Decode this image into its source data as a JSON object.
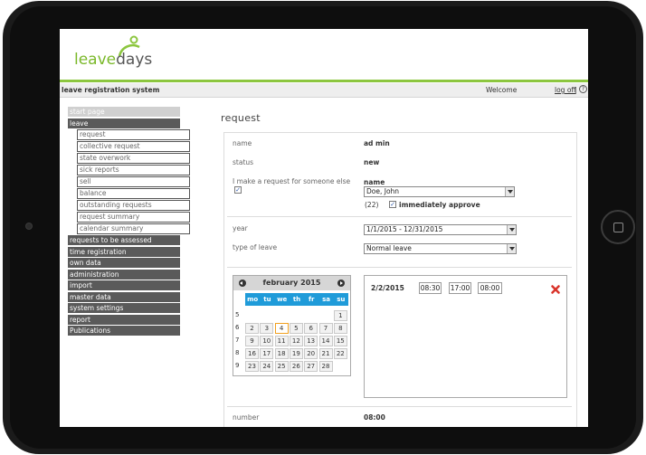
{
  "app": {
    "logo_part1": "leave",
    "logo_part2": "days",
    "system_name": "leave registration system",
    "welcome": "Welcome",
    "logoff": "log off",
    "separator": "|",
    "help_icon": "?"
  },
  "colors": {
    "brand_green": "#8cc63f",
    "calendar_blue": "#1f9bd9",
    "menu_dark": "#5a5a5a"
  },
  "menu": {
    "start_page": "start page",
    "leave": "leave",
    "sub": [
      "request",
      "collective request",
      "state overwork",
      "sick reports",
      "sell",
      "balance",
      "outstanding requests",
      "request summary",
      "calendar summary"
    ],
    "sections": [
      "requests to be assessed",
      "time registration",
      "own data",
      "administration",
      "import",
      "master data",
      "system settings",
      "report",
      "Publications"
    ]
  },
  "form": {
    "title": "request",
    "name_label": "name",
    "name_value": "ad min",
    "status_label": "status",
    "status_value": "new",
    "someone_else_label": "I make a request for someone else",
    "someone_else_checked": "✓",
    "person_label": "name",
    "person_value": "Doe, John",
    "count": "(22)",
    "approve_checked": "✓",
    "approve_label": "immediately approve",
    "year_label": "year",
    "year_value": "1/1/2015 - 12/31/2015",
    "type_label": "type of leave",
    "type_value": "Normal leave",
    "number_label": "number",
    "number_value": "08:00"
  },
  "calendar": {
    "month": "february 2015",
    "weekdays": [
      "mo",
      "tu",
      "we",
      "th",
      "fr",
      "sa",
      "su"
    ],
    "weeks": [
      {
        "wk": "5",
        "days": [
          "",
          "",
          "",
          "",
          "",
          "",
          "1"
        ]
      },
      {
        "wk": "6",
        "days": [
          "2",
          "3",
          "4",
          "5",
          "6",
          "7",
          "8"
        ]
      },
      {
        "wk": "7",
        "days": [
          "9",
          "10",
          "11",
          "12",
          "13",
          "14",
          "15"
        ]
      },
      {
        "wk": "8",
        "days": [
          "16",
          "17",
          "18",
          "19",
          "20",
          "21",
          "22"
        ]
      },
      {
        "wk": "9",
        "days": [
          "23",
          "24",
          "25",
          "26",
          "27",
          "28",
          ""
        ]
      }
    ],
    "today": "4"
  },
  "entry": {
    "date": "2/2/2015",
    "from": "08:30",
    "to": "17:00",
    "duration": "08:00"
  }
}
